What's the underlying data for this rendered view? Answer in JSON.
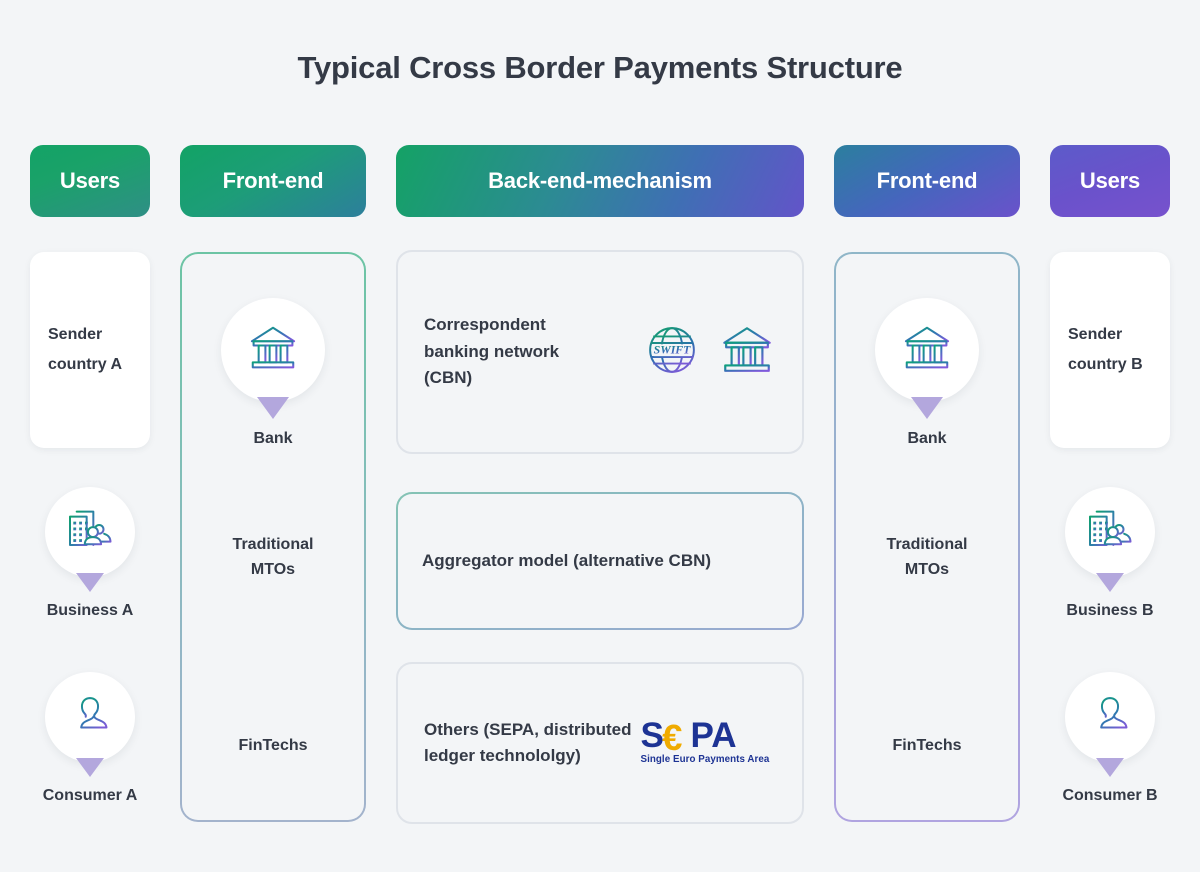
{
  "title": "Typical Cross Border Payments Structure",
  "colors": {
    "background": "#f3f5f7",
    "text": "#343a46",
    "green": "#13a365",
    "teal": "#2d8b93",
    "blue": "#3f6fb4",
    "purple": "#6a52cb",
    "pin": "#b3a7dd",
    "sepa_blue": "#1d3394",
    "sepa_gold": "#f0ab00"
  },
  "headers": [
    {
      "label": "Users",
      "name": "header-users-a"
    },
    {
      "label": "Front-end",
      "name": "header-front-end-a"
    },
    {
      "label": "Back-end-mechanism",
      "name": "header-back-end"
    },
    {
      "label": "Front-end",
      "name": "header-front-end-b"
    },
    {
      "label": "Users",
      "name": "header-users-b"
    }
  ],
  "users_a": {
    "card_label": "Sender\ncountry A",
    "card_line1": "Sender",
    "card_line2": "country A",
    "pins": [
      {
        "label": "Business A",
        "icon": "building-people-icon"
      },
      {
        "label": "Consumer A",
        "icon": "person-icon"
      }
    ]
  },
  "users_b": {
    "card_line1": "Sender",
    "card_line2": "country B",
    "pins": [
      {
        "label": "Business B",
        "icon": "building-people-icon"
      },
      {
        "label": "Consumer B",
        "icon": "person-icon"
      }
    ]
  },
  "front_end_a": {
    "bank_label": "Bank",
    "bank_icon": "bank-icon",
    "items": [
      {
        "line1": "Traditional",
        "line2": "MTOs"
      },
      {
        "line1": "FinTechs",
        "line2": ""
      }
    ]
  },
  "front_end_b": {
    "bank_label": "Bank",
    "bank_icon": "bank-icon",
    "items": [
      {
        "line1": "Traditional",
        "line2": "MTOs"
      },
      {
        "line1": "FinTechs",
        "line2": ""
      }
    ]
  },
  "back_end": {
    "cbn": {
      "line1": "Correspondent",
      "line2": "banking network",
      "line3": "(CBN)",
      "icons": [
        "swift-globe-icon",
        "bank-icon"
      ],
      "swift_text": "SWIFT"
    },
    "aggregator": {
      "label": "Aggregator model (alternative CBN)"
    },
    "others": {
      "line1": "Others (SEPA, distributed",
      "line2": "ledger technololgy)",
      "logo": {
        "name": "sepa-logo",
        "mark_s": "S",
        "mark_euro": "€",
        "mark_pa": "PA",
        "tagline": "Single Euro Payments Area"
      }
    }
  }
}
